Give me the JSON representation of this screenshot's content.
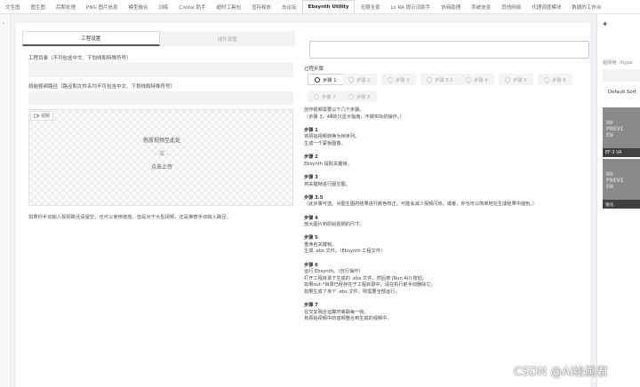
{
  "top_tabs": [
    "文生图",
    "图生图",
    "后期处理",
    "PNG 图片信息",
    "模型融合",
    "训练",
    "Civitai 助手",
    "超时工具包",
    "显存释放",
    "去论坛",
    "Ebsynth Utility",
    "无限全景",
    "Lo RA 提示词助手",
    "协商助理",
    "系统信息",
    "其他网络",
    "代理调度模块",
    "数据的工作台"
  ],
  "active_top_tab": "Ebsynth Utility",
  "left_edge_icon": "chevron-left-icon",
  "settings_tabs": [
    "工程设置",
    "插件设置"
  ],
  "project_dir_label": "工程目录（不可包含中文、下划线和特殊符号）",
  "project_dir_value": "",
  "video_path_label": "原始视频路径（路径和文件名均不可包含中文、下划线和特殊符号）",
  "video_path_value": "",
  "video_widget": {
    "tag_label": "视频",
    "tag_icon": "video-icon",
    "drop_text": "拖放视频至此处",
    "or_text": "- 或 -",
    "click_text": "点击上传"
  },
  "upload_note": "如果你手动输入视频路径请留空，也可以使用拖放。但是对于大型视频，还是推荐手动输入路径。",
  "output_box_value": "",
  "steps_label": "过程步骤",
  "steps": [
    {
      "label": "步骤 1",
      "selected": true
    },
    {
      "label": "步骤 2",
      "selected": false
    },
    {
      "label": "步骤 3",
      "selected": false
    },
    {
      "label": "步骤 3.5",
      "selected": false
    },
    {
      "label": "步骤 4",
      "selected": false
    },
    {
      "label": "步骤 5",
      "selected": false
    },
    {
      "label": "步骤 6",
      "selected": false
    },
    {
      "label": "步骤 7",
      "selected": false
    },
    {
      "label": "步骤 8",
      "selected": false
    }
  ],
  "guide": [
    {
      "kind": "line",
      "text": "创作视频需要以下几个步骤。"
    },
    {
      "kind": "line",
      "text": "（步骤 3、4和6只显示指南，不做实际的操作。）"
    },
    {
      "kind": "gap"
    },
    {
      "kind": "head",
      "text": "步骤 1"
    },
    {
      "kind": "line",
      "text": "将原始视频转换为帧序列。"
    },
    {
      "kind": "line",
      "text": "生成一个蒙板图像。"
    },
    {
      "kind": "gap"
    },
    {
      "kind": "head",
      "text": "步骤 2"
    },
    {
      "kind": "line",
      "text": "Ebsynth 提取关键帧。"
    },
    {
      "kind": "gap"
    },
    {
      "kind": "head",
      "text": "步骤 3"
    },
    {
      "kind": "line",
      "text": "将关键帧进行图生图。"
    },
    {
      "kind": "gap"
    },
    {
      "kind": "head",
      "text": "步骤 3.5"
    },
    {
      "kind": "line",
      "text": "（此步骤可选。对图生图的结果进行颜色校正，可能会减少视频闪烁。或者，你也可以简单地在生成结果中褪色。）"
    },
    {
      "kind": "gap"
    },
    {
      "kind": "head",
      "text": "步骤 4"
    },
    {
      "kind": "line",
      "text": "放大图片到原始视频的尺寸。"
    },
    {
      "kind": "gap"
    },
    {
      "kind": "head",
      "text": "步骤 5"
    },
    {
      "kind": "line",
      "text": "重命名关键帧。"
    },
    {
      "kind": "line",
      "text": "生成 .ebs 文件。（Ebsynth 工程文件）"
    },
    {
      "kind": "gap"
    },
    {
      "kind": "head",
      "text": "步骤 6"
    },
    {
      "kind": "line",
      "text": "运行 Ebsynth。（自行操作）"
    },
    {
      "kind": "line",
      "text": "打开工程目录下生成的 .ebs 文件，然后按 [Run All] 按钮。"
    },
    {
      "kind": "line",
      "text": "如果out-*目录已经存在于工程目录中，请在执行前手动删除它。"
    },
    {
      "kind": "line",
      "text": "如果生成了多个 .ebs 文件，则需要全部运行。"
    },
    {
      "kind": "gap"
    },
    {
      "kind": "head",
      "text": "步骤 7"
    },
    {
      "kind": "line",
      "text": "在交叉融合运算时串联每一帧。"
    },
    {
      "kind": "line",
      "text": "将原始视频中的音频整合到生成的视频中。"
    }
  ],
  "right_column": {
    "top_icon_text": "✚",
    "row1": "超网络（hype",
    "sort_label": "Default Sort",
    "thumbnails": [
      {
        "placeholder": "NO\nPREVI\nEW",
        "caption": "EF-3 VA"
      },
      {
        "placeholder": "NO\nPREVI\nEW",
        "caption": "锐化"
      }
    ]
  },
  "watermark": "CSDN @AI绘画君"
}
